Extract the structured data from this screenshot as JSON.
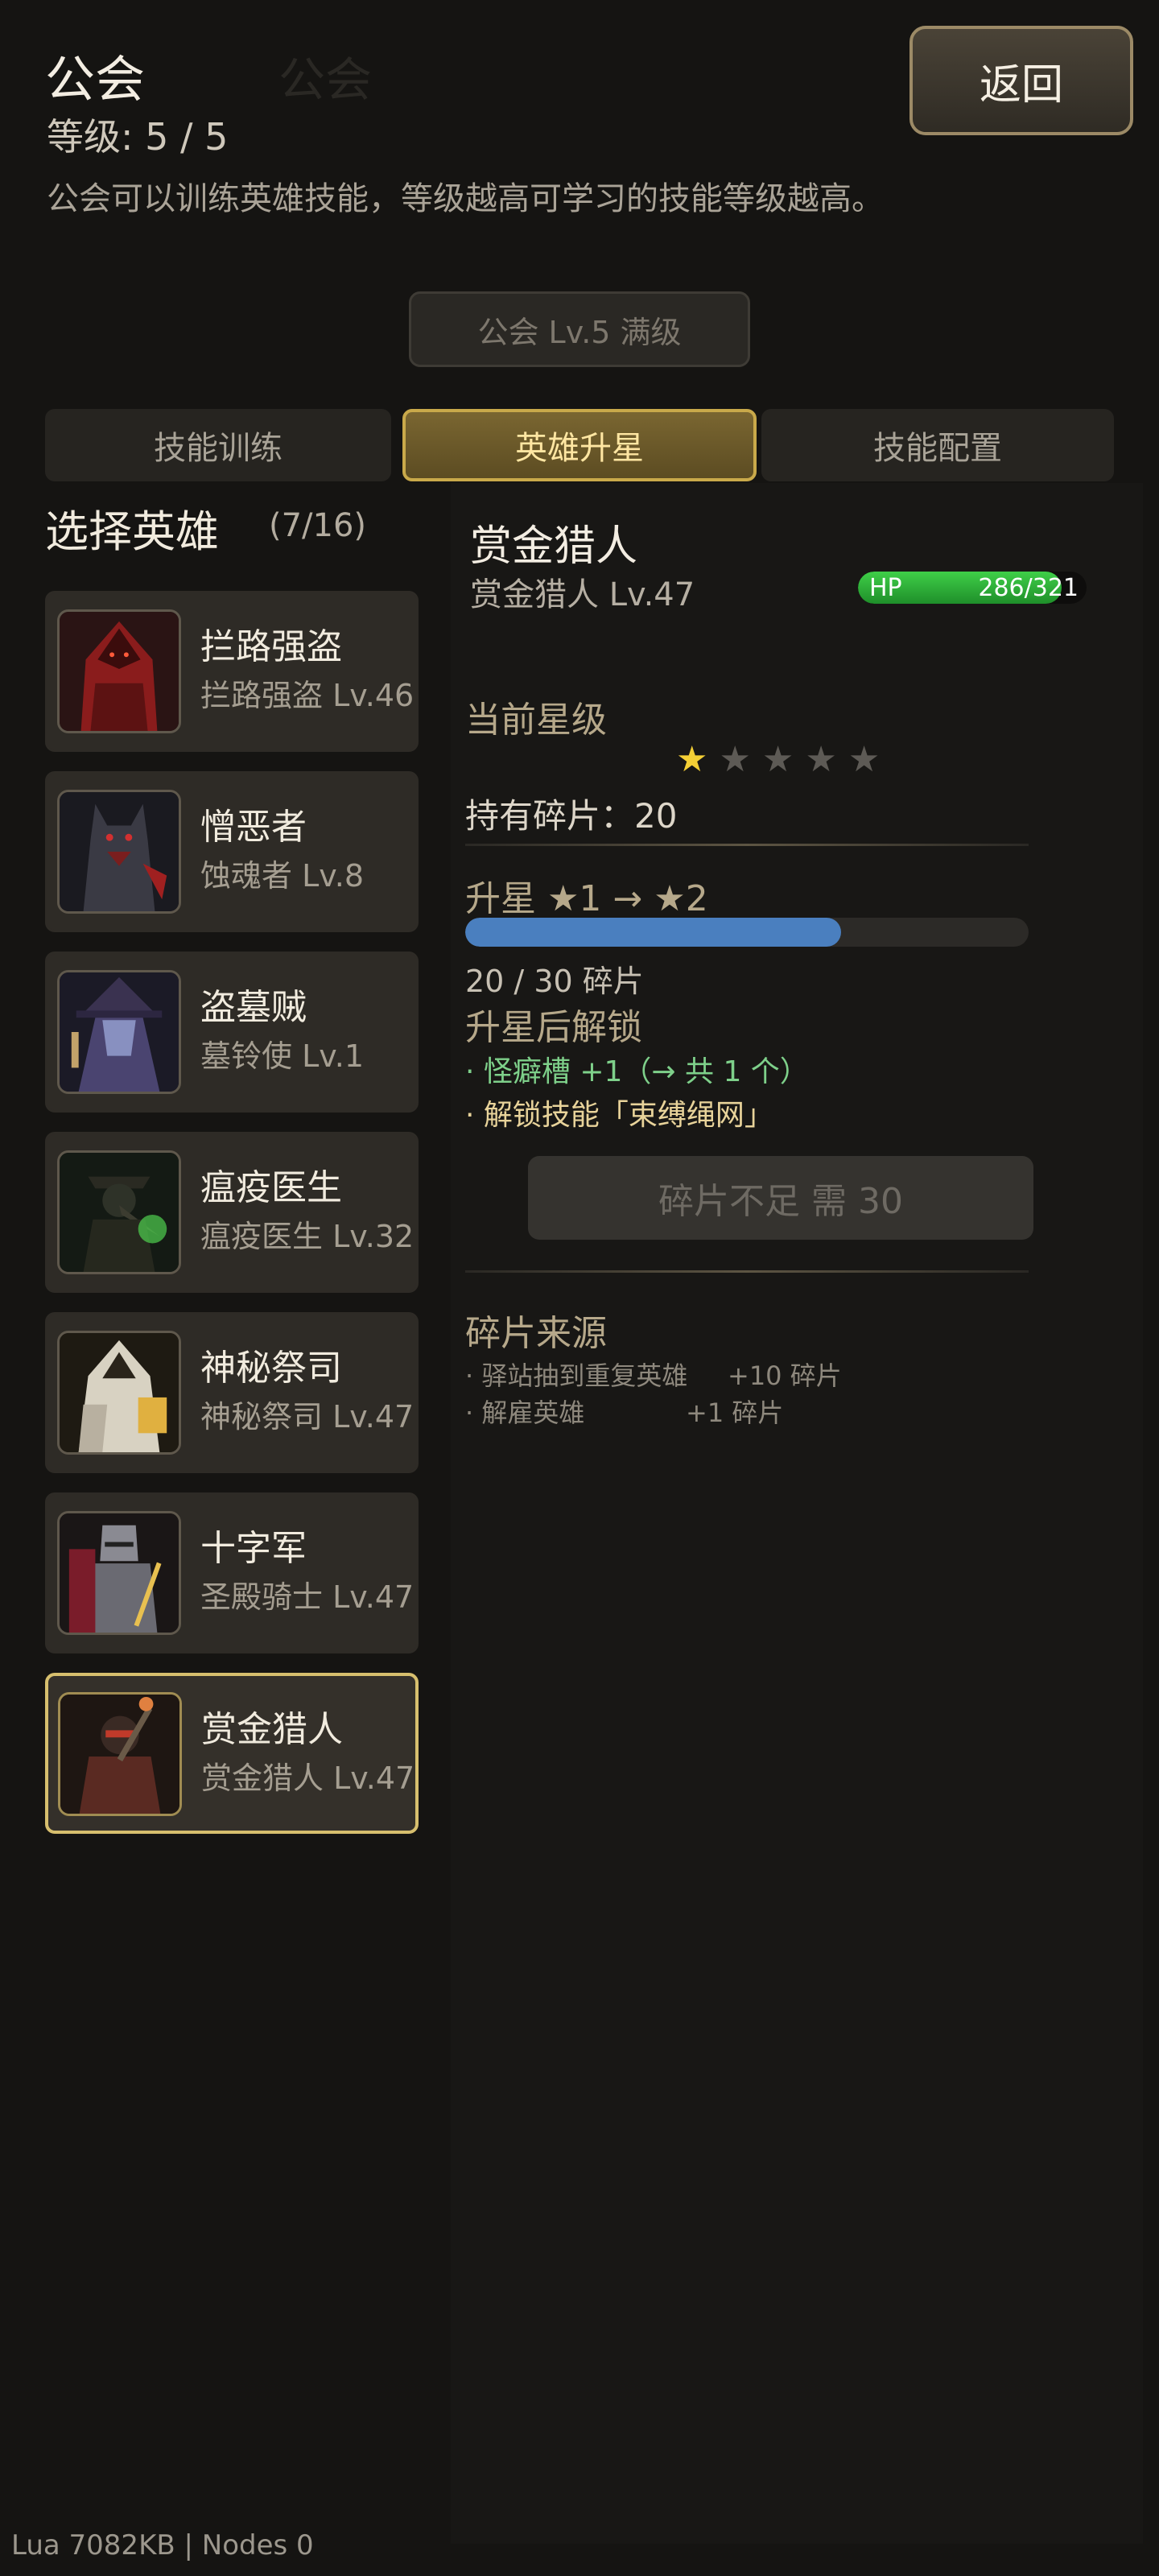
{
  "header": {
    "title": "公会",
    "level": "等级: 5 / 5",
    "description": "公会可以训练英雄技能，等级越高可学习的技能等级越高。",
    "back_label": "返回"
  },
  "guild_badge": "公会 Lv.5 满级",
  "tabs": [
    {
      "label": "技能训练",
      "active": false
    },
    {
      "label": "英雄升星",
      "active": true
    },
    {
      "label": "技能配置",
      "active": false
    }
  ],
  "hero_select": {
    "title": "选择英雄",
    "count": "(7/16)",
    "heroes": [
      {
        "name": "拦路强盗",
        "sub": "拦路强盗 Lv.46",
        "icon": "red-hooded-bandit-portrait"
      },
      {
        "name": "憎恶者",
        "sub": "蚀魂者 Lv.8",
        "icon": "werewolf-abomination-portrait"
      },
      {
        "name": "盗墓贼",
        "sub": "墓铃使 Lv.1",
        "icon": "grave-robber-witch-portrait"
      },
      {
        "name": "瘟疫医生",
        "sub": "瘟疫医生 Lv.32",
        "icon": "plague-doctor-portrait"
      },
      {
        "name": "神秘祭司",
        "sub": "神秘祭司 Lv.47",
        "icon": "mystic-priest-portrait"
      },
      {
        "name": "十字军",
        "sub": "圣殿骑士 Lv.47",
        "icon": "crusader-knight-portrait"
      },
      {
        "name": "赏金猎人",
        "sub": "赏金猎人 Lv.47",
        "icon": "bounty-hunter-portrait",
        "selected": true
      }
    ]
  },
  "detail": {
    "name": "赏金猎人",
    "sub": "赏金猎人 Lv.47",
    "hp_label": "HP",
    "hp_value": "286/321",
    "hp_fraction": 0.891,
    "star_label": "当前星级",
    "stars_filled": 1,
    "stars_total": 5,
    "shards_text": "持有碎片：20",
    "upgrade_title": "升星 ★1 → ★2",
    "progress_fraction": 0.667,
    "progress_text": "20 / 30 碎片",
    "unlock_title": "升星后解锁",
    "unlock_items": [
      "· 怪癖槽 +1（→ 共 1 个）",
      "· 解锁技能「束缚绳网」"
    ],
    "need_button": "碎片不足  需 30",
    "source_title": "碎片来源",
    "sources": [
      {
        "label": "· 驿站抽到重复英雄",
        "value": "+10 碎片"
      },
      {
        "label": "· 解雇英雄",
        "value": "+1 碎片"
      }
    ]
  },
  "colors": {
    "accent_gold": "#c9a94a",
    "hp_green": "#3fcf48",
    "progress_blue": "#4a7fbf",
    "star_gold": "#f4cf35"
  },
  "footer": "Lua 7082KB | Nodes 0"
}
